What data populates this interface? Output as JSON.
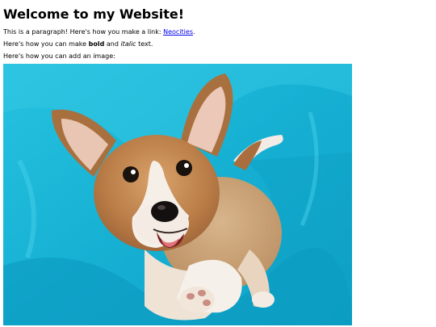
{
  "heading": "Welcome to my Website!",
  "paragraph_link": {
    "before": "This is a paragraph! Here's how you make a link: ",
    "link_text": "Neocities",
    "after": "."
  },
  "paragraph_style": {
    "before": "Here's how you can make ",
    "bold": "bold",
    "middle": " and ",
    "italic": "italic",
    "after": " text."
  },
  "paragraph_image": "Here's how you can add an image:",
  "colors": {
    "link": "#0000ee",
    "image_background": "#1fb8d6"
  },
  "image": {
    "subject": "corgi puppy on blue blanket"
  }
}
